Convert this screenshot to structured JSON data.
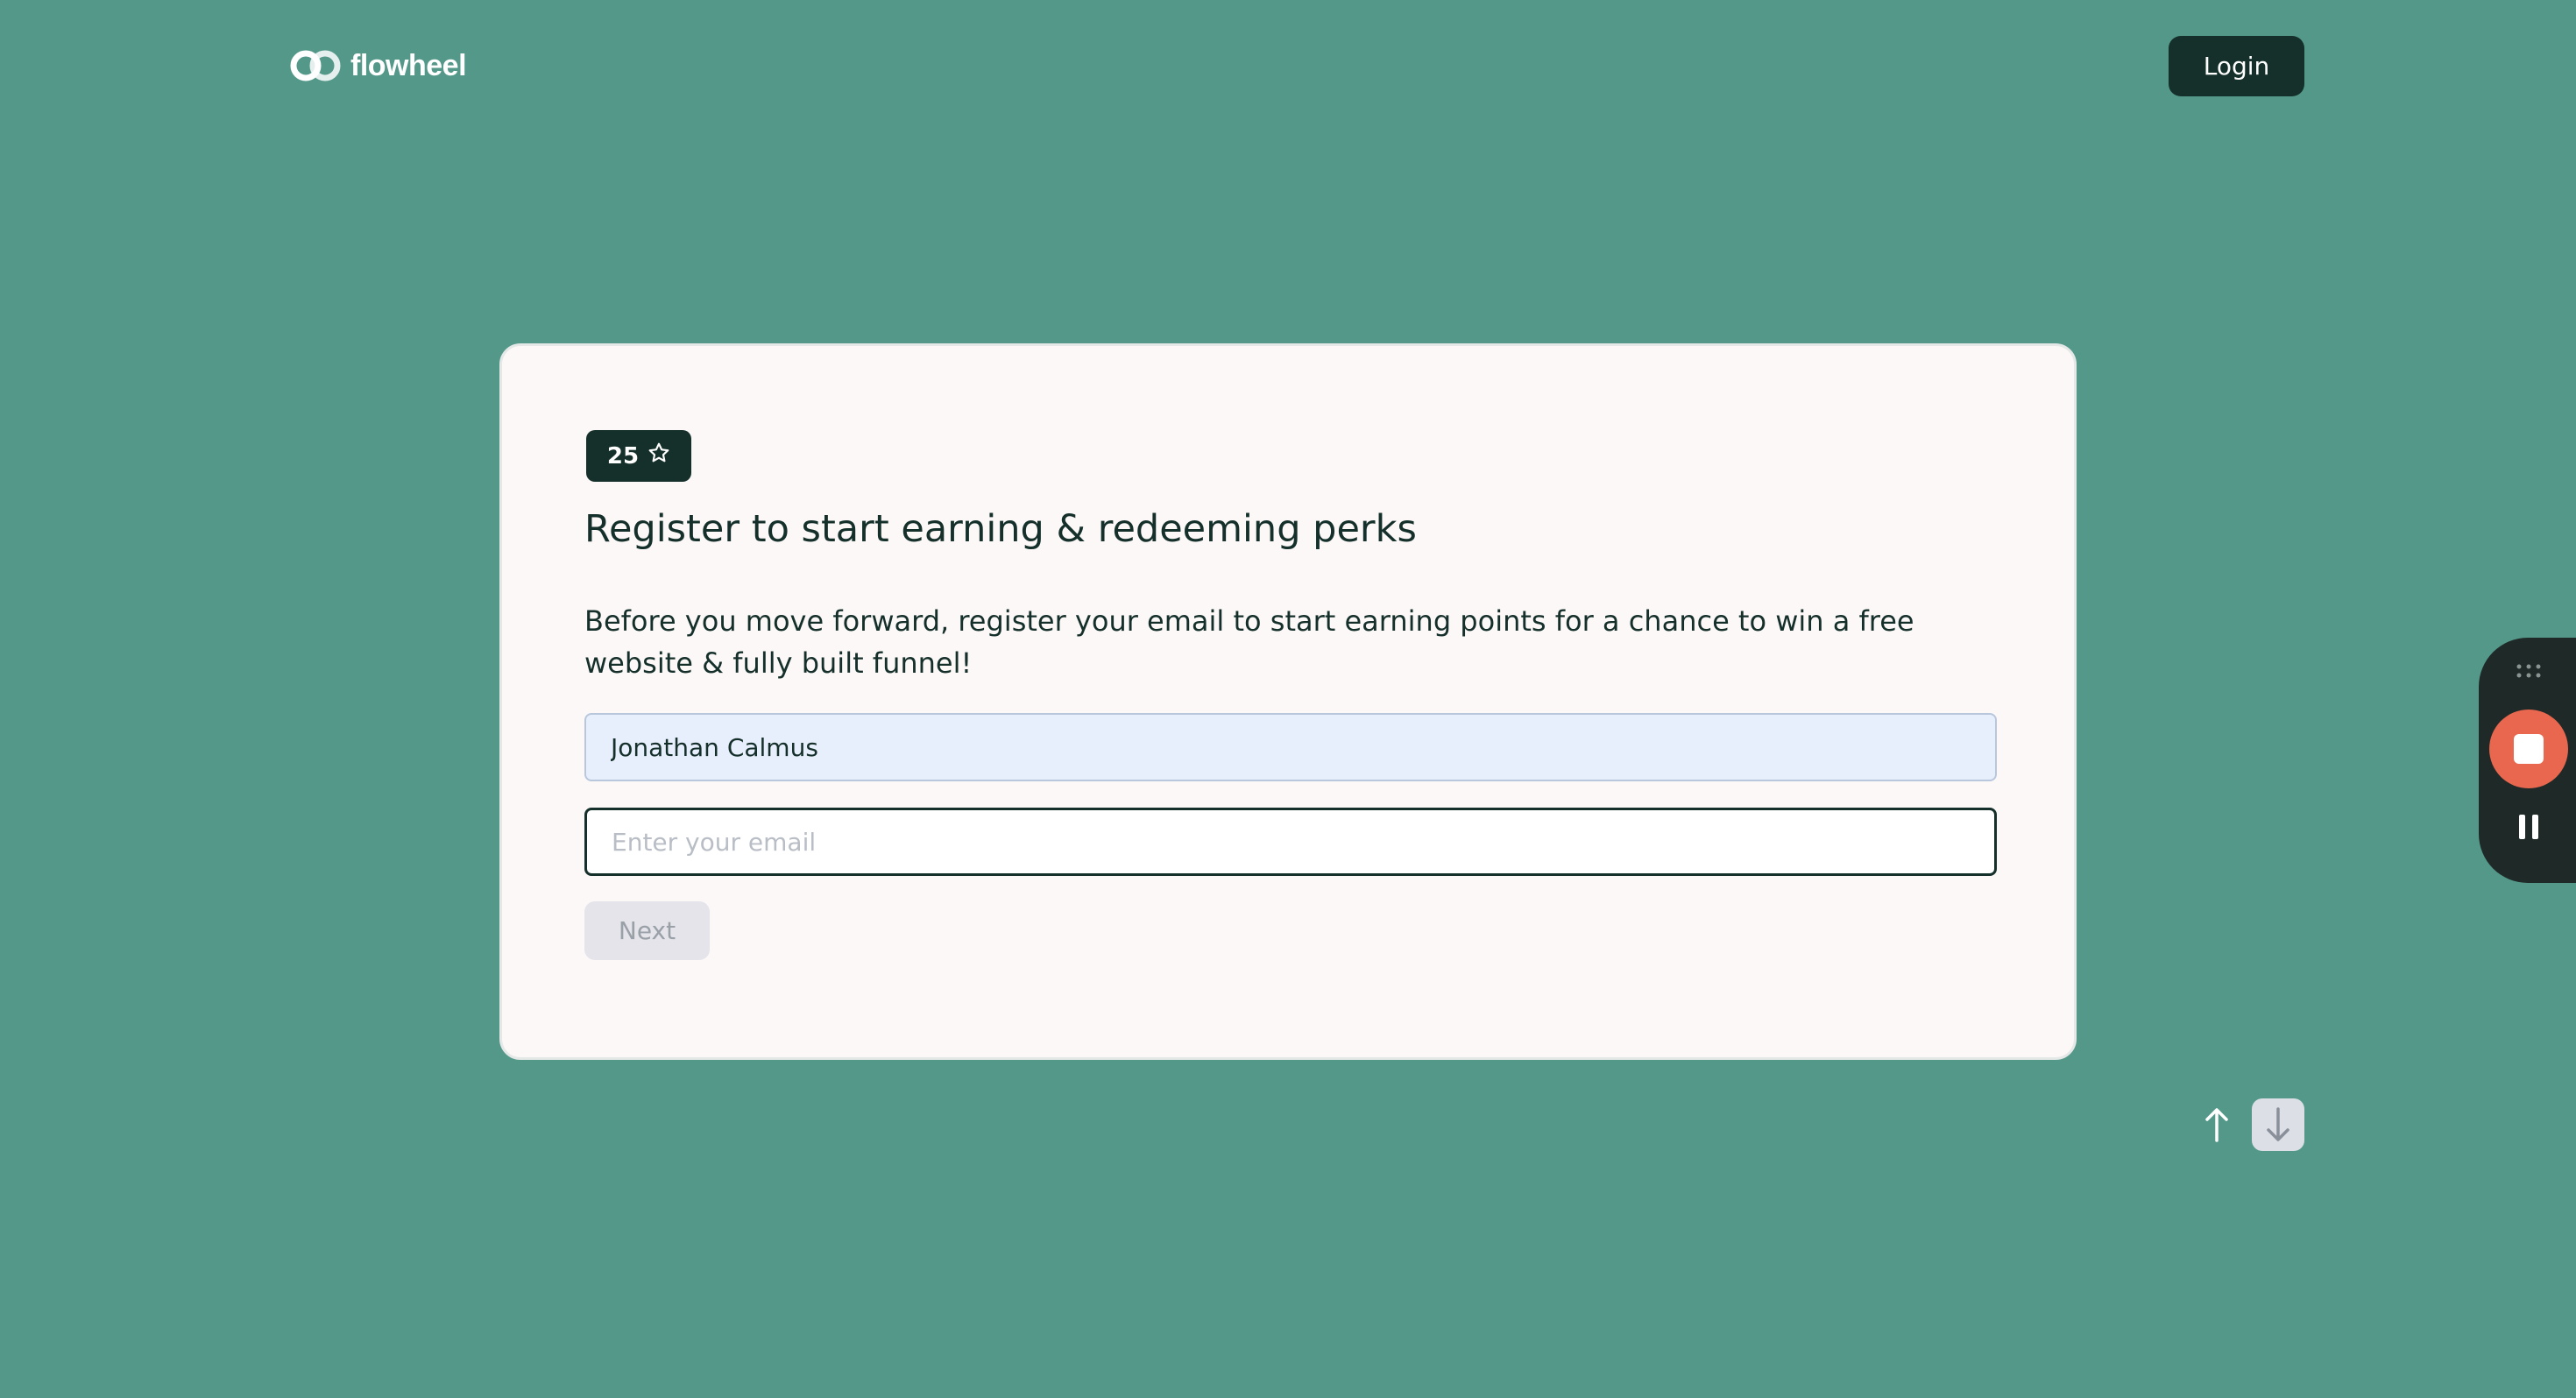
{
  "header": {
    "logo_text": "flowheel",
    "login_label": "Login"
  },
  "card": {
    "points": "25",
    "points_icon": "star-outline-icon",
    "title": "Register to start earning & redeeming perks",
    "description": "Before you move forward, register your email to start earning points for a chance to win a free website & fully built funnel!",
    "name_value": "Jonathan Calmus",
    "email_value": "",
    "email_placeholder": "Enter your email",
    "next_label": "Next"
  },
  "navigation": {
    "up_icon": "arrow-up-icon",
    "down_icon": "arrow-down-icon"
  },
  "recorder": {
    "grip_icon": "drag-grip-icon",
    "stop_icon": "stop-icon",
    "pause_icon": "pause-icon"
  },
  "colors": {
    "background": "#54988a",
    "primary_dark": "#15302a",
    "card_bg": "#fdf8f8",
    "record_accent": "#e8674e"
  }
}
